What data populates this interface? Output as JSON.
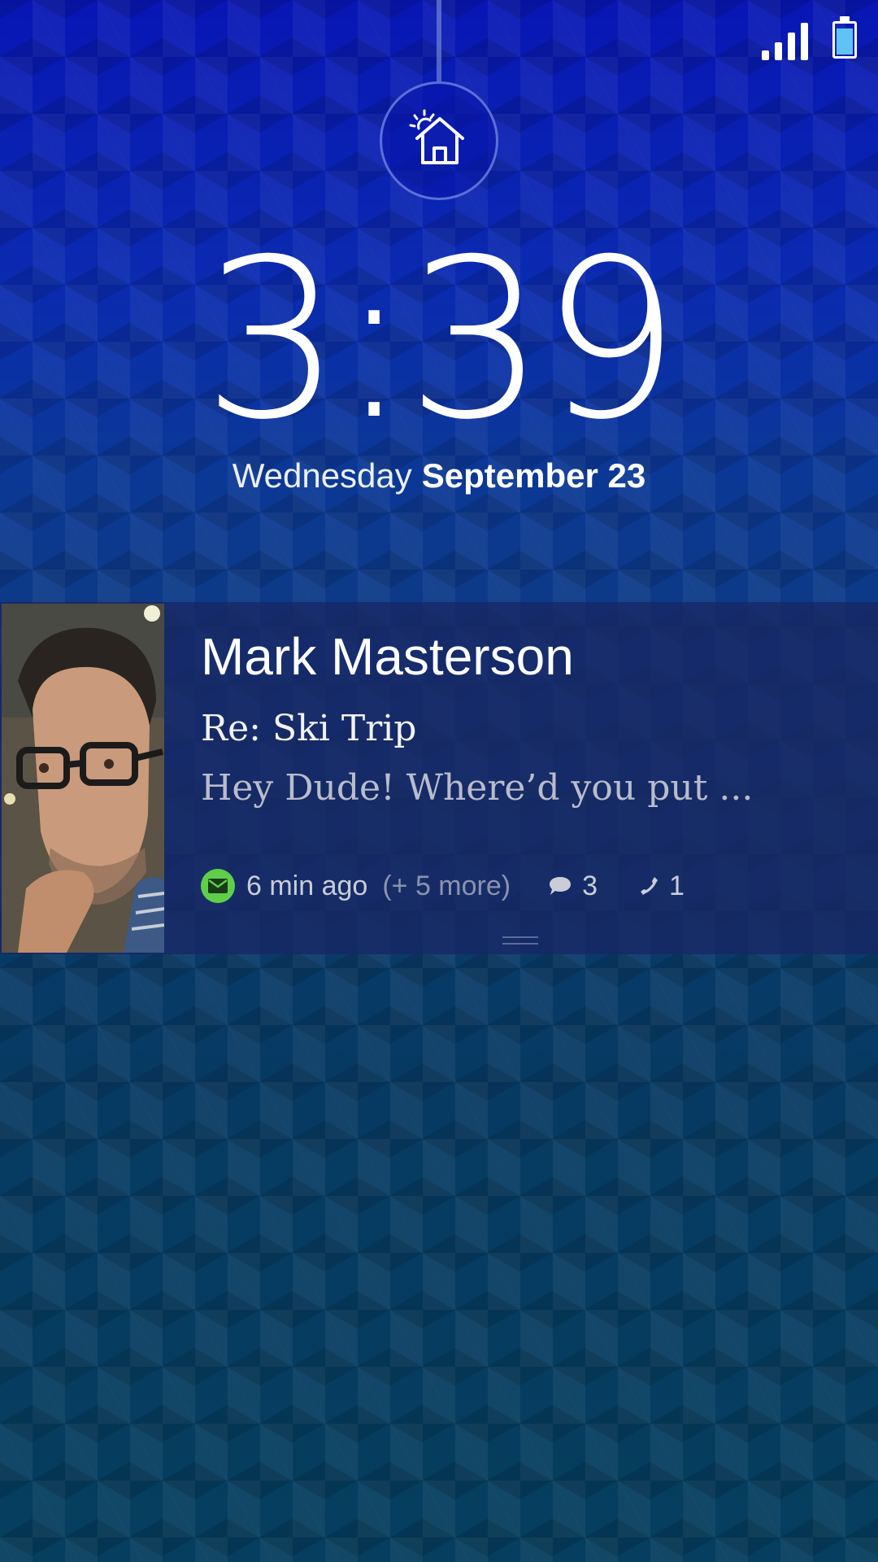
{
  "status_bar": {
    "signal_bars": 4,
    "battery_level": 0.85,
    "battery_color": "#5ec4f5"
  },
  "lock_icon": {
    "icon": "home-sun-icon"
  },
  "clock": {
    "time": "3:39",
    "weekday": "Wednesday",
    "date": "September 23"
  },
  "notification": {
    "sender": "Mark Masterson",
    "subject": "Re: Ski Trip",
    "preview": "Hey Dude! Where’d  you put ...",
    "app_icon": "mail-icon",
    "app_color": "#5fcf4a",
    "time_ago": "6 min ago",
    "more": "(+ 5 more)",
    "messages_count": "3",
    "calls_count": "1"
  }
}
